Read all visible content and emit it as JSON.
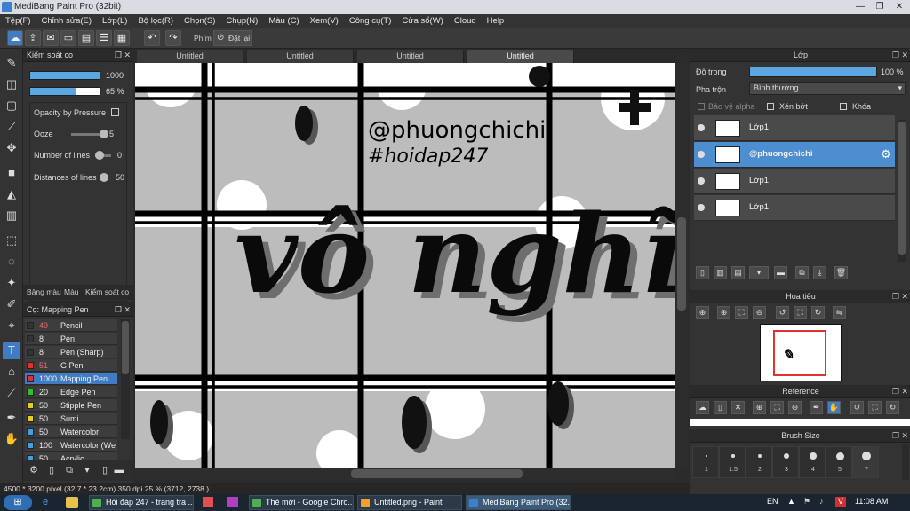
{
  "window": {
    "title": "MediBang Paint Pro (32bit)"
  },
  "menu": [
    "Tệp(F)",
    "Chỉnh sửa(E)",
    "Lớp(L)",
    "Bộ lọc(R)",
    "Chọn(S)",
    "Chụp(N)",
    "Màu (C)",
    "Xem(V)",
    "Công cụ(T)",
    "Cửa sổ(W)",
    "Cloud",
    "Help"
  ],
  "toolbar": {
    "key_label": "Phím",
    "reset_label": "Đặt lại"
  },
  "brush_panel": {
    "title": "Kiểm soát co",
    "size_value": "1000",
    "opacity_value": "65 %",
    "opacity_fraction": 0.65,
    "props": [
      {
        "label": "Opacity by Pressure"
      },
      {
        "label": "Ooze",
        "value": "5"
      },
      {
        "label": "Number of lines",
        "value": "0"
      },
      {
        "label": "Distances of lines",
        "value": "50"
      }
    ]
  },
  "left_tabs": [
    "Bảng màu",
    "Màu",
    "Kiểm soát co"
  ],
  "brush_list": {
    "title": "Cọ: Mapping Pen",
    "items": [
      {
        "size": "49",
        "name": "Pencil",
        "color": "#333333"
      },
      {
        "size": "8",
        "name": "Pen",
        "color": "#333333"
      },
      {
        "size": "8",
        "name": "Pen (Sharp)",
        "color": "#333333"
      },
      {
        "size": "51",
        "name": "G Pen",
        "color": "#e03030"
      },
      {
        "size": "1000",
        "name": "Mapping Pen",
        "color": "#e03030"
      },
      {
        "size": "20",
        "name": "Edge Pen",
        "color": "#30c030"
      },
      {
        "size": "50",
        "name": "Stipple Pen",
        "color": "#e0d020"
      },
      {
        "size": "50",
        "name": "Sumi",
        "color": "#e0d020"
      },
      {
        "size": "50",
        "name": "Watercolor",
        "color": "#40a0e0"
      },
      {
        "size": "100",
        "name": "Watercolor (We",
        "color": "#40a0e0"
      },
      {
        "size": "50",
        "name": "Acrylic",
        "color": "#40a0e0"
      }
    ]
  },
  "canvas_tabs": [
    "Untitled",
    "Untitled",
    "Untitled",
    "Untitled"
  ],
  "canvas_text": {
    "handle": "@phuongchichi",
    "hashtag": "#hoidap247",
    "main": "vô nghĩa"
  },
  "status": {
    "text": "4500 * 3200 pixel  (32.7 * 23.2cm)  350 dpi  25 %  (3712, 2738 )"
  },
  "layer_panel": {
    "title": "Lớp",
    "opacity_label": "Độ trong",
    "opacity_value": "100 %",
    "blend_label": "Pha trộn",
    "blend_value": "Bình thường",
    "checks": [
      "Bảo vệ alpha",
      "Xén bớt",
      "Khóa"
    ],
    "layers": [
      "Lớp1",
      "@phuongchichi",
      "Lớp1",
      "Lớp1"
    ]
  },
  "navigator": {
    "title": "Hoa tiêu"
  },
  "reference": {
    "title": "Reference"
  },
  "brush_size": {
    "title": "Brush Size",
    "sizes": [
      "1",
      "1.5",
      "2",
      "3",
      "4",
      "5",
      "7"
    ]
  },
  "taskbar": {
    "tasks": [
      "Hỏi đáp 247 - trang tra ...",
      "Thẻ mới - Google Chro...",
      "Untitled.png - Paint",
      "MediBang Paint Pro (32..."
    ],
    "lang": "EN",
    "time": "11:08 AM"
  }
}
